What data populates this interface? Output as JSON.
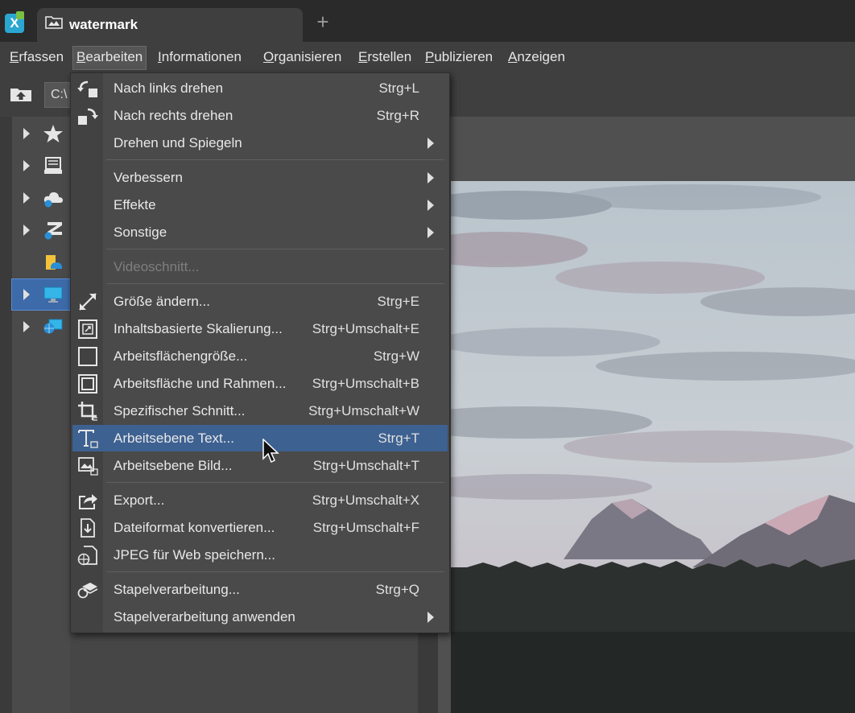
{
  "window": {
    "tab_title": "watermark",
    "tab_add": "+"
  },
  "menubar": {
    "items": [
      {
        "first": "E",
        "rest": "rfassen"
      },
      {
        "first": "B",
        "rest": "earbeiten"
      },
      {
        "first": "I",
        "rest": "nformationen"
      },
      {
        "first": "O",
        "rest": "rganisieren"
      },
      {
        "first": "E",
        "rest": "rstellen"
      },
      {
        "first": "P",
        "rest": "ublizieren"
      },
      {
        "first": "A",
        "rest": "nzeigen"
      }
    ],
    "active_index": 1
  },
  "toolbar": {
    "path_value": "C:\\"
  },
  "tree": {
    "items": [
      {
        "icon": "star-icon"
      },
      {
        "icon": "drive-icon"
      },
      {
        "icon": "cloud-icon"
      },
      {
        "icon": "zoner-cloud-icon"
      },
      {
        "icon": "user-folder-icon"
      },
      {
        "icon": "desktop-icon",
        "selected": true
      },
      {
        "icon": "network-icon"
      }
    ]
  },
  "dropdown": {
    "items": [
      {
        "label": "Nach links drehen",
        "shortcut": "Strg+L",
        "icon": "rotate-left-icon"
      },
      {
        "label": "Nach rechts drehen",
        "shortcut": "Strg+R",
        "icon": "rotate-right-icon"
      },
      {
        "label": "Drehen und Spiegeln",
        "shortcut": "",
        "submenu": true
      },
      {
        "label": "Verbessern",
        "shortcut": "",
        "submenu": true
      },
      {
        "label": "Effekte",
        "shortcut": "",
        "submenu": true
      },
      {
        "label": "Sonstige",
        "shortcut": "",
        "submenu": true
      },
      {
        "label": "Videoschnitt...",
        "shortcut": "",
        "disabled": true
      },
      {
        "label": "Größe ändern...",
        "shortcut": "Strg+E",
        "icon": "resize-icon"
      },
      {
        "label": "Inhaltsbasierte Skalierung...",
        "shortcut": "Strg+Umschalt+E",
        "icon": "content-aware-scale-icon"
      },
      {
        "label": "Arbeitsflächengröße...",
        "shortcut": "Strg+W",
        "icon": "canvas-size-icon"
      },
      {
        "label": "Arbeitsfläche und Rahmen...",
        "shortcut": "Strg+Umschalt+B",
        "icon": "canvas-frame-icon"
      },
      {
        "label": "Spezifischer Schnitt...",
        "shortcut": "Strg+Umschalt+W",
        "icon": "crop-icon"
      },
      {
        "label": "Arbeitsebene Text...",
        "shortcut": "Strg+T",
        "icon": "text-layer-icon",
        "highlighted": true
      },
      {
        "label": "Arbeitsebene Bild...",
        "shortcut": "Strg+Umschalt+T",
        "icon": "image-layer-icon"
      },
      {
        "label": "Export...",
        "shortcut": "Strg+Umschalt+X",
        "icon": "export-icon"
      },
      {
        "label": "Dateiformat konvertieren...",
        "shortcut": "Strg+Umschalt+F",
        "icon": "convert-format-icon"
      },
      {
        "label": "JPEG für Web speichern...",
        "shortcut": "",
        "icon": "save-web-icon"
      },
      {
        "label": "Stapelverarbeitung...",
        "shortcut": "Strg+Q",
        "icon": "batch-icon"
      },
      {
        "label": "Stapelverarbeitung anwenden",
        "shortcut": "",
        "submenu": true
      }
    ]
  },
  "colors": {
    "highlight": "#3d6191",
    "selection": "#3d6aa8",
    "menu_bg": "#4a4a4a",
    "app_bg": "#3a3a3a"
  }
}
